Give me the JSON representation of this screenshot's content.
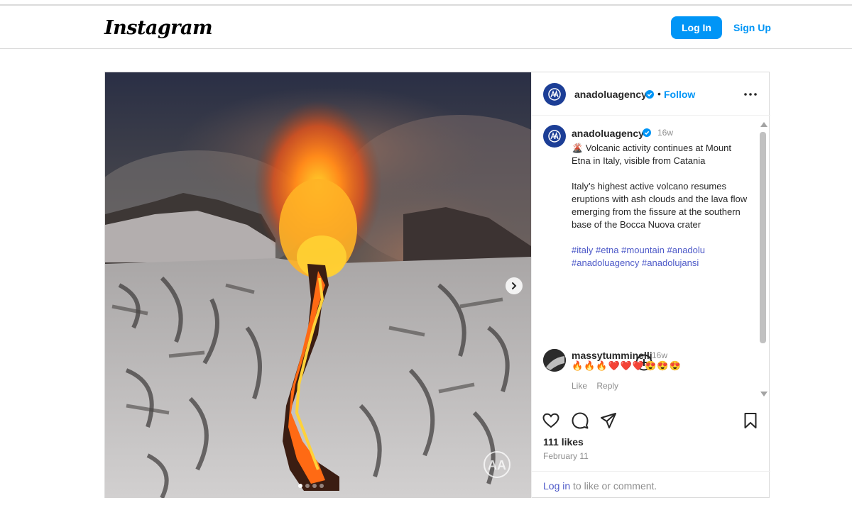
{
  "header": {
    "logo": "Instagram",
    "login_label": "Log In",
    "signup_label": "Sign Up"
  },
  "media": {
    "watermark": "AA",
    "carousel_dots": 4,
    "active_dot": 0
  },
  "post": {
    "author": "anadoluagency",
    "verified": true,
    "follow_label": "Follow",
    "separator": "•",
    "caption": {
      "author": "anadoluagency",
      "time": "16w",
      "line1": "🌋 Volcanic activity continues at Mount Etna in Italy, visible from Catania",
      "line2": "Italy’s highest active volcano resumes eruptions with ash clouds and the lava flow emerging from the fissure at the southern base of the Bocca Nuova crater",
      "hashtags": [
        "#italy",
        "#etna",
        "#mountain",
        "#anadolu",
        "#anadoluagency",
        "#anadolujansi"
      ]
    },
    "comments": [
      {
        "author": "massytumminelli",
        "time": "16w",
        "text": "🔥🔥🔥❤️❤️❤️😍😍😍",
        "like_label": "Like",
        "reply_label": "Reply"
      }
    ],
    "likes": "111 likes",
    "date": "February 11",
    "login_prompt": {
      "link": "Log in",
      "rest": " to like or comment."
    }
  },
  "icons": {
    "more": "more-horizontal-icon",
    "like": "heart-icon",
    "comment": "comment-bubble-icon",
    "share": "paper-plane-icon",
    "save": "bookmark-icon",
    "load_more": "plus-circle-icon",
    "next": "chevron-right-icon"
  },
  "colors": {
    "accent": "#0095f6",
    "hashtag": "#4d59c8",
    "avatar_bg": "#1c3e96",
    "verified": "#0095f6"
  }
}
